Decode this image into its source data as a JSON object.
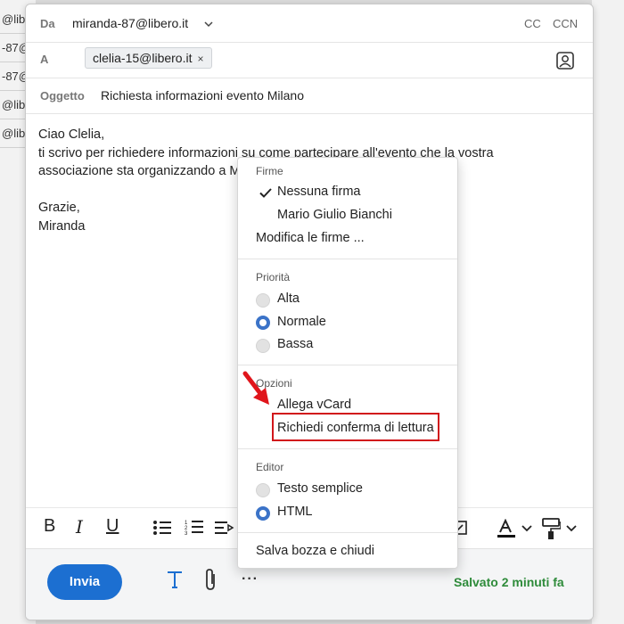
{
  "background_rows": [
    "@lib",
    "-87@",
    "-87@",
    "@lib",
    "@lib"
  ],
  "compose": {
    "from_label": "Da",
    "from_value": "miranda-87@libero.it",
    "cc_label": "CC",
    "ccn_label": "CCN",
    "to_label": "A",
    "to_chip": "clelia-15@libero.it",
    "to_chip_remove": "×",
    "subject_label": "Oggetto",
    "subject_value": "Richiesta informazioni evento Milano",
    "body_lines": [
      "Ciao Clelia,",
      "ti scrivo per richiedere informazioni su come partecipare all'evento che la vostra",
      "associazione sta organizzando a M",
      "",
      "Grazie,",
      "Miranda"
    ]
  },
  "toolbar": {
    "bold": "B",
    "italic": "I",
    "underline": "U"
  },
  "footer": {
    "send_label": "Invia",
    "more_label": "···",
    "saved_label": "Salvato 2 minuti fa"
  },
  "menu": {
    "firme_title": "Firme",
    "firme_items": [
      "Nessuna firma",
      "Mario Giulio Bianchi"
    ],
    "firme_selected": "Nessuna firma",
    "firme_edit": "Modifica le firme ...",
    "priorita_title": "Priorità",
    "priorita_items": [
      "Alta",
      "Normale",
      "Bassa"
    ],
    "priorita_selected": "Normale",
    "opzioni_title": "Opzioni",
    "opzioni_items": [
      "Allega vCard",
      "Richiedi conferma di lettura"
    ],
    "editor_title": "Editor",
    "editor_items": [
      "Testo semplice",
      "HTML"
    ],
    "editor_selected": "HTML",
    "save_close": "Salva bozza e chiudi"
  },
  "colors": {
    "accent": "#1c6fd1",
    "radio_on": "#3b73c8",
    "highlight": "#d1161b",
    "saved": "#2e8b3a"
  }
}
